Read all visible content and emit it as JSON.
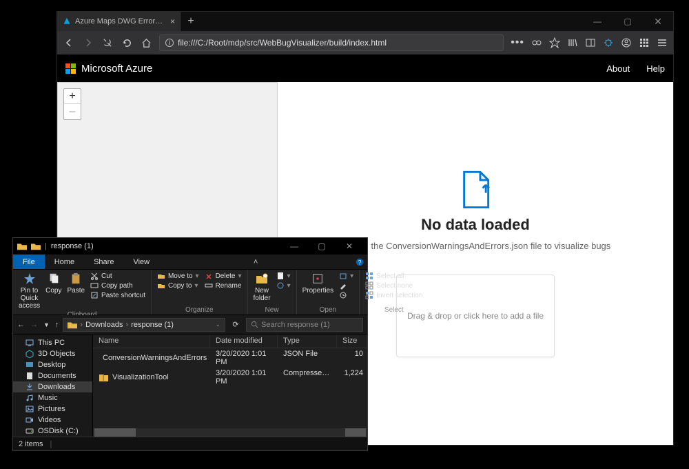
{
  "browser": {
    "tab_title": "Azure Maps DWG Errors Visua",
    "url": "file:///C:/Root/mdp/src/WebBugVisualizer/build/index.html",
    "win_min": "—",
    "win_max": "▢",
    "win_close": "✕"
  },
  "azure": {
    "brand": "Microsoft Azure",
    "nav_about": "About",
    "nav_help": "Help",
    "zoom_in": "+",
    "zoom_out": "–",
    "title": "No data loaded",
    "subtitle": "Upload the ConversionWarningsAndErrors.json file to visualize bugs",
    "dropzone": "Drag & drop or click here to add a file"
  },
  "explorer": {
    "title": "response (1)",
    "tabs": {
      "file": "File",
      "home": "Home",
      "share": "Share",
      "view": "View"
    },
    "ribbon": {
      "clipboard": {
        "label": "Clipboard",
        "pin": "Pin to Quick access",
        "copy": "Copy",
        "paste": "Paste",
        "cut": "Cut",
        "copy_path": "Copy path",
        "paste_shortcut": "Paste shortcut"
      },
      "organize": {
        "label": "Organize",
        "move": "Move to",
        "copy_to": "Copy to",
        "delete": "Delete",
        "rename": "Rename"
      },
      "new": {
        "label": "New",
        "new_folder": "New folder"
      },
      "open": {
        "label": "Open",
        "properties": "Properties"
      },
      "select": {
        "label": "Select",
        "all": "Select all",
        "none": "Select none",
        "invert": "Invert selection"
      }
    },
    "path": {
      "root": "Downloads",
      "folder": "response (1)",
      "search_placeholder": "Search response (1)"
    },
    "columns": {
      "name": "Name",
      "date": "Date modified",
      "type": "Type",
      "size": "Size"
    },
    "nav": [
      {
        "label": "This PC",
        "icon": "pc"
      },
      {
        "label": "3D Objects",
        "icon": "3d"
      },
      {
        "label": "Desktop",
        "icon": "desktop"
      },
      {
        "label": "Documents",
        "icon": "doc"
      },
      {
        "label": "Downloads",
        "icon": "dl",
        "selected": true
      },
      {
        "label": "Music",
        "icon": "music"
      },
      {
        "label": "Pictures",
        "icon": "pic"
      },
      {
        "label": "Videos",
        "icon": "vid"
      },
      {
        "label": "OSDisk (C:)",
        "icon": "disk"
      }
    ],
    "files": [
      {
        "name": "ConversionWarningsAndErrors",
        "date": "3/20/2020 1:01 PM",
        "type": "JSON File",
        "size": "10",
        "icon": "json"
      },
      {
        "name": "VisualizationTool",
        "date": "3/20/2020 1:01 PM",
        "type": "Compressed (zipp...",
        "size": "1,224",
        "icon": "zip"
      }
    ],
    "status": "2 items"
  }
}
